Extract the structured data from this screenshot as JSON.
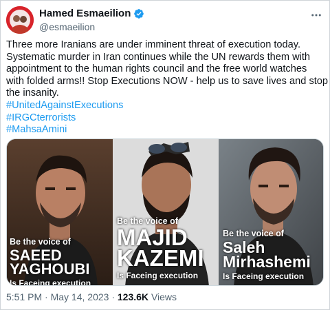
{
  "author": {
    "display_name": "Hamed Esmaeilion",
    "handle": "@esmaeilion",
    "avatar_icon": "avatar-portrait",
    "verified_icon": "verified-badge-icon",
    "verified_color": "#1d9bf0"
  },
  "tweet": {
    "lines": [
      "Three more Iranians are under imminent threat of execution today.",
      "Systematic murder in Iran continues while the UN rewards them with",
      "appointment to the human rights council and the free world watches",
      "with folded arms!! Stop Executions NOW - help us to save lives and stop",
      "the insanity."
    ],
    "hashtags": [
      "#UnitedAgainstExecutions",
      "#IRGCterrorists",
      "#MahsaAmini"
    ],
    "hashtag_color": "#1d9bf0"
  },
  "media": {
    "panels": [
      {
        "voice": "Be the voice of",
        "name_line1": "SAEED",
        "name_line2": "YAGHOUBI",
        "status": "Is Faceing execution"
      },
      {
        "voice": "Be the voice of",
        "name_line1": "MAJID",
        "name_line2": "KAZEMI",
        "status": "Is Faceing execution"
      },
      {
        "voice": "Be the voice of",
        "name_line1": "Saleh",
        "name_line2": "Mirhashemi",
        "status": "Is Faceing execution"
      }
    ]
  },
  "footer": {
    "time": "5:51 PM",
    "separator": "·",
    "date": "May 14, 2023",
    "views_count": "123.6K",
    "views_label": "Views"
  }
}
